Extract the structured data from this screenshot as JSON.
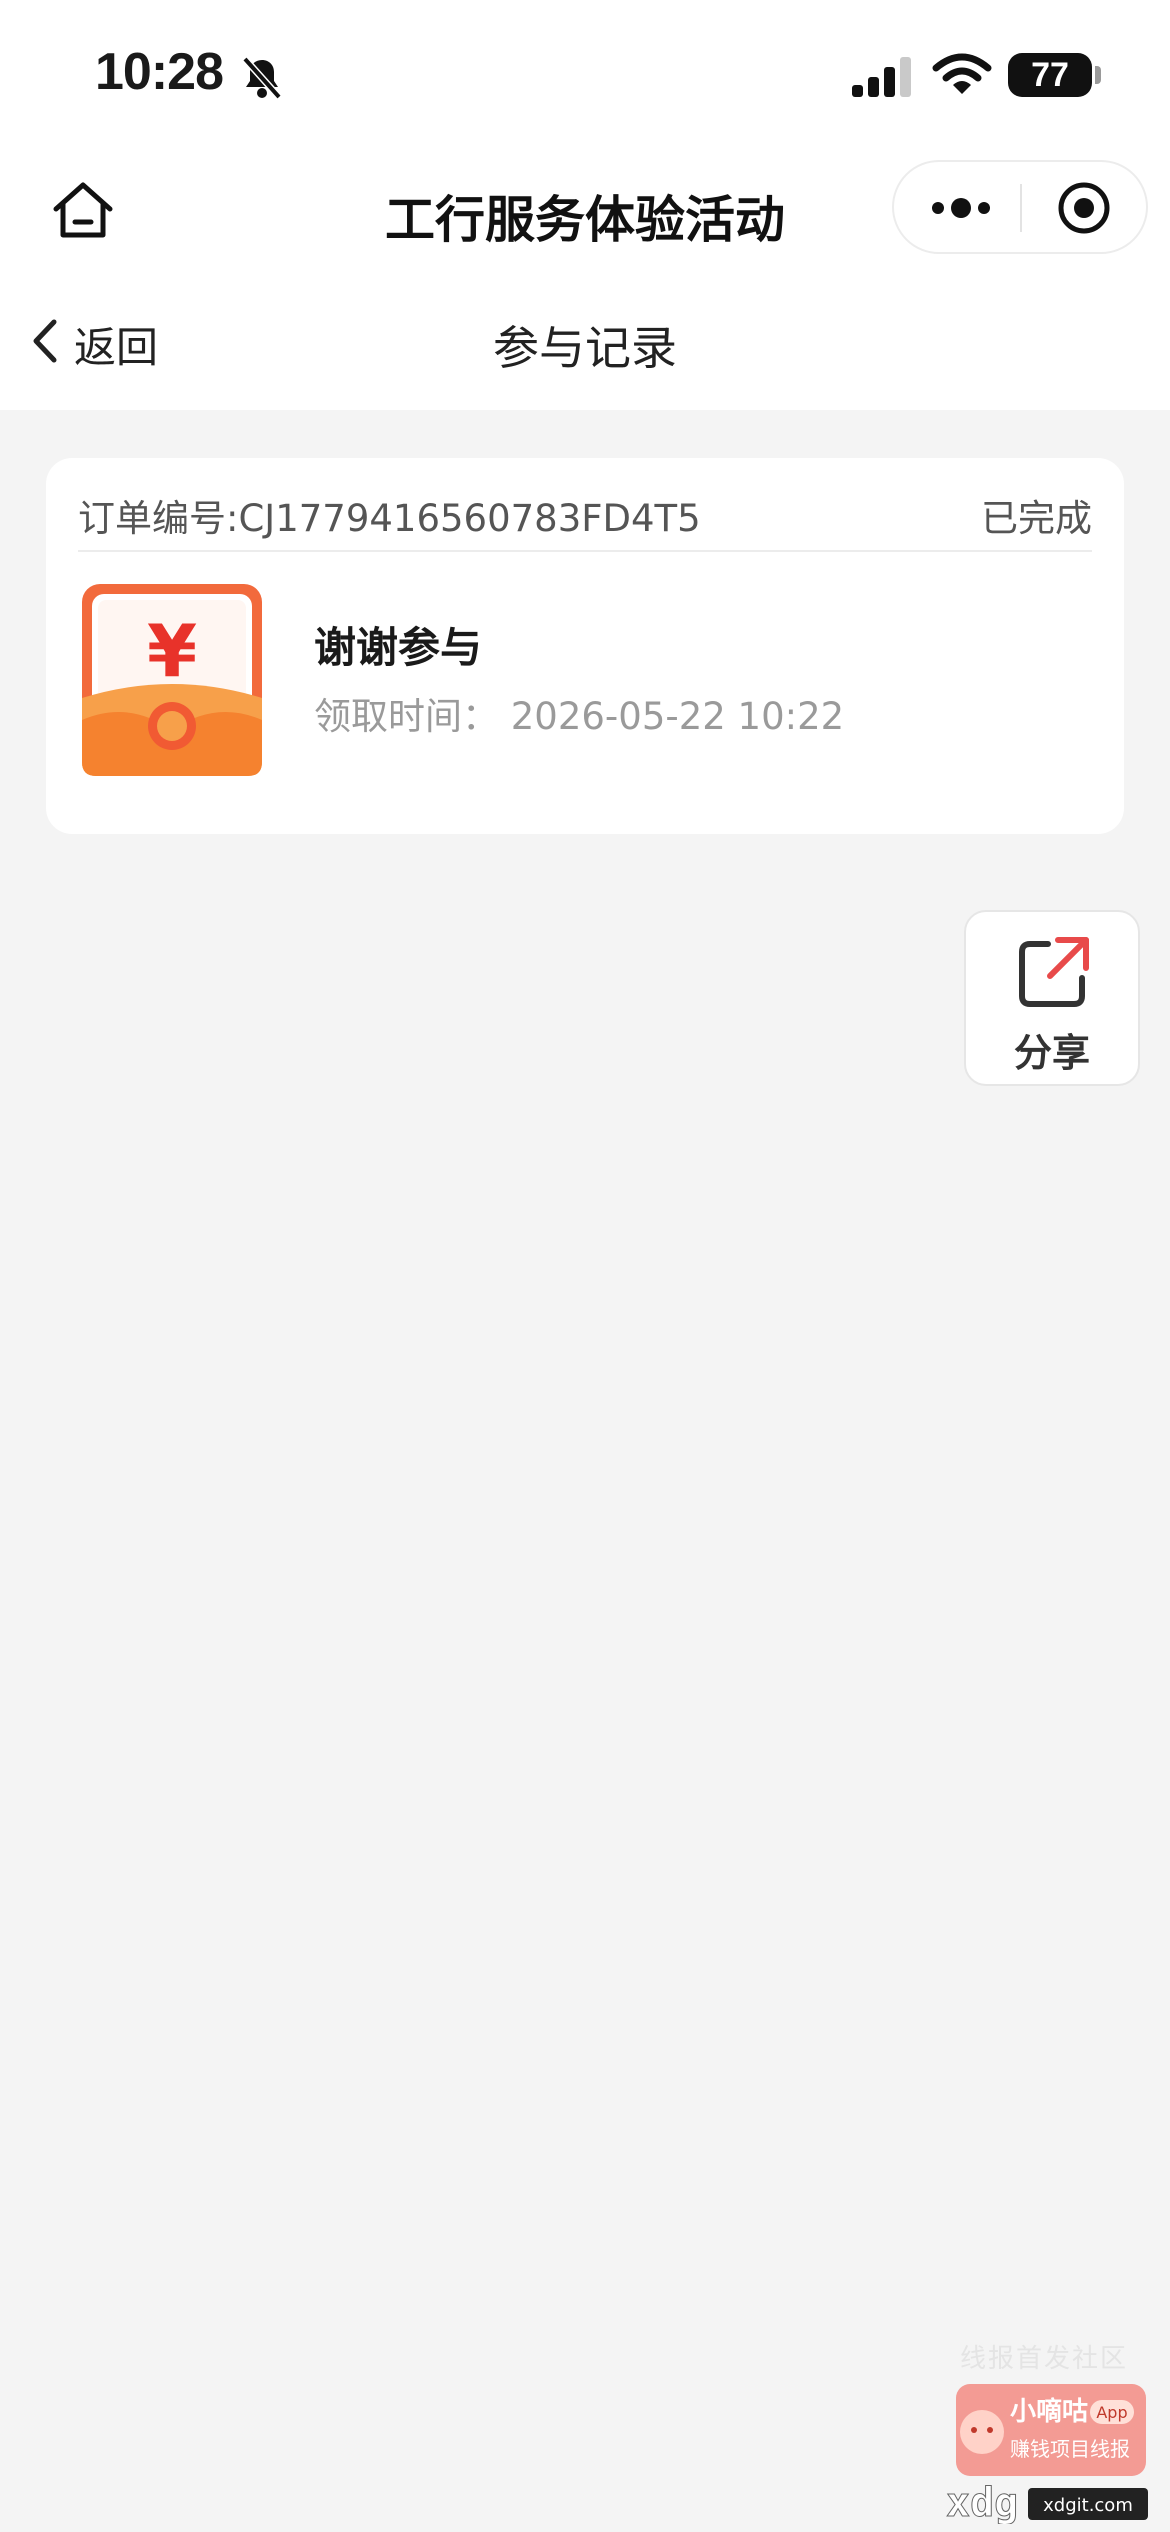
{
  "status_bar": {
    "time": "10:28",
    "battery": "77",
    "icons": [
      "bell-slash-icon",
      "signal-icon",
      "wifi-icon",
      "battery-icon"
    ]
  },
  "nav_bar": {
    "title": "工行服务体验活动",
    "icons": [
      "home-icon",
      "more-dots-icon",
      "close-target-icon"
    ]
  },
  "sub_header": {
    "back_label": "返回",
    "title": "参与记录"
  },
  "records": [
    {
      "order_no": "订单编号:CJ1779416560783FD4T5",
      "status": "已完成",
      "prize_name": "谢谢参与",
      "claim_time": "领取时间：  2026-05-22 10:22",
      "icon": "red-envelope-yuan-icon"
    }
  ],
  "share": {
    "label": "分享",
    "icon": "share-external-icon"
  },
  "watermark": {
    "caption": "线报首发社区",
    "brand": "小嘀咕",
    "badge": "App",
    "tagline": "赚钱项目线报",
    "domain": "xdgit.com"
  },
  "colors": {
    "background": "#f4f4f4",
    "card": "#ffffff",
    "envelope_red": "#e8432f",
    "envelope_orange": "#f7a04a",
    "share_arrow": "#e84a4a"
  }
}
